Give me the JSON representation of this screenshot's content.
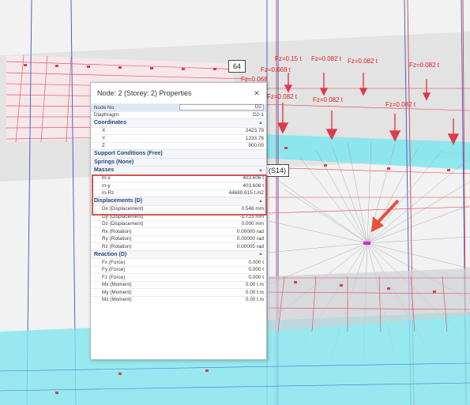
{
  "viewport": {
    "node_id_tag": "64",
    "section_tag": "(S14)",
    "load_labels": [
      "Fz=0.15 t",
      "Fz=0.082 t",
      "Fz=0.082 t",
      "Fz=0.082 t",
      "Fz=0.068 t",
      "Fz=0.068",
      "Fz=0.082 t",
      "Fz=0.082 t",
      "Fz=0.082 t"
    ]
  },
  "panel": {
    "title": "Node: 2 (Storey: 2) Properties",
    "close_icon": "close-icon",
    "top_rows": [
      {
        "label": "Node No",
        "value": "D2"
      },
      {
        "label": "Diaphragm",
        "value": "D2-1"
      }
    ],
    "sections": [
      {
        "title": "Coordinates",
        "rows": [
          {
            "label": "X",
            "value": "2423.79"
          },
          {
            "label": "Y",
            "value": "1233.76"
          },
          {
            "label": "Z",
            "value": "900.00"
          }
        ]
      },
      {
        "title": "Support Conditions (Free)",
        "rows": []
      },
      {
        "title": "Springs (None)",
        "rows": []
      },
      {
        "title": "Masses",
        "rows": [
          {
            "label": "m-x",
            "value": "403.606 t"
          },
          {
            "label": "m-y",
            "value": "403.606 t"
          },
          {
            "label": "m-Rz",
            "value": "44680.615 t.m2"
          }
        ]
      },
      {
        "title": "Displacements (D)",
        "rows": [
          {
            "label": "Dx (Displacement)",
            "value": "0.548 mm"
          },
          {
            "label": "Dy (Displacement)",
            "value": "-1.723 mm"
          },
          {
            "label": "Dz (Displacement)",
            "value": "0.000 mm"
          },
          {
            "label": "Rx (Rotation)",
            "value": "0.00000 rad"
          },
          {
            "label": "Ry (Rotation)",
            "value": "0.00000 rad"
          },
          {
            "label": "Rz (Rotation)",
            "value": "0.00005 rad"
          }
        ]
      },
      {
        "title": "Reaction (D)",
        "rows": [
          {
            "label": "Fx (Force)",
            "value": "0.000 t"
          },
          {
            "label": "Fy (Force)",
            "value": "0.000 t"
          },
          {
            "label": "Fz (Force)",
            "value": "0.000 t"
          },
          {
            "label": "Mx (Moment)",
            "value": "0.00 t.m"
          },
          {
            "label": "My (Moment)",
            "value": "0.00 t.m"
          },
          {
            "label": "Mz (Moment)",
            "value": "0.00 t.m"
          }
        ]
      }
    ]
  },
  "colors": {
    "accent_red": "#d9534f",
    "slab_cyan": "#7fe6ee",
    "section_blue": "#24477a",
    "node_magenta": "#e020e0"
  }
}
